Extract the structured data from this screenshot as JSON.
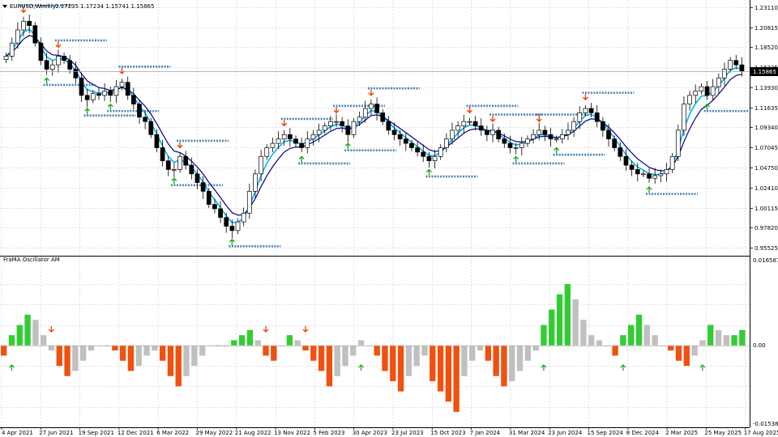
{
  "main_chart": {
    "symbol_label": "EURUSD,Weekly",
    "ohlc_label": "1.17235 1.17234 1.15741 1.15865",
    "current_price": "1.15865",
    "price_labels": [
      "1.23110",
      "1.20815",
      "1.18520",
      "1.16225",
      "1.13930",
      "1.11635",
      "1.09340",
      "1.07045",
      "1.04750",
      "1.02410",
      "1.00115",
      "0.97820",
      "0.95525"
    ],
    "colors": {
      "bull": "#ffffff",
      "bear": "#000000",
      "fast_line": "#00b7eb",
      "slow_line": "#00008b",
      "dash": "#4682b4",
      "arrow_up": "#22aa22",
      "arrow_down": "#ee4400",
      "price_tag": "#000000"
    }
  },
  "oscillator": {
    "title": "FraMA Oscillator AM",
    "scale_labels": [
      "0.016587",
      "0.00",
      "-0.015384"
    ],
    "colors": {
      "pos_strong": "#33cc33",
      "neg_strong": "#f05010",
      "weak": "#c0c0c0"
    }
  },
  "x_axis": {
    "labels": [
      "4 Apr 2021",
      "27 Jun 2021",
      "19 Sep 2021",
      "12 Dec 2021",
      "6 Mar 2022",
      "29 May 2022",
      "21 Aug 2022",
      "13 Nov 2022",
      "5 Feb 2023",
      "30 Apr 2023",
      "23 Jul 2023",
      "15 Oct 2023",
      "7 Jan 2024",
      "31 Mar 2024",
      "23 Jun 2024",
      "15 Sep 2024",
      "8 Dec 2024",
      "2 Mar 2025",
      "25 May 2025",
      "17 Aug 2025"
    ]
  },
  "chart_data": [
    {
      "type": "candlestick",
      "title": "EURUSD,Weekly",
      "ylim": [
        0.948,
        1.2375
      ],
      "close_series": [
        1.175,
        1.19,
        1.205,
        1.215,
        1.21,
        1.19,
        1.17,
        1.16,
        1.165,
        1.175,
        1.17,
        1.16,
        1.15,
        1.13,
        1.125,
        1.132,
        1.13,
        1.135,
        1.13,
        1.14,
        1.145,
        1.13,
        1.12,
        1.105,
        1.1,
        1.085,
        1.07,
        1.055,
        1.045,
        1.045,
        1.06,
        1.05,
        1.04,
        1.03,
        1.02,
        1.005,
        1.0,
        0.99,
        0.98,
        0.975,
        0.985,
        0.995,
        1.02,
        1.04,
        1.06,
        1.07,
        1.075,
        1.08,
        1.085,
        1.08,
        1.075,
        1.07,
        1.08,
        1.085,
        1.09,
        1.095,
        1.1,
        1.1,
        1.095,
        1.085,
        1.1,
        1.105,
        1.115,
        1.12,
        1.11,
        1.1,
        1.09,
        1.085,
        1.08,
        1.075,
        1.07,
        1.065,
        1.06,
        1.055,
        1.06,
        1.07,
        1.08,
        1.09,
        1.095,
        1.1,
        1.1,
        1.095,
        1.09,
        1.085,
        1.09,
        1.08,
        1.075,
        1.07,
        1.07,
        1.075,
        1.08,
        1.085,
        1.09,
        1.085,
        1.08,
        1.08,
        1.085,
        1.09,
        1.1,
        1.11,
        1.115,
        1.11,
        1.1,
        1.09,
        1.08,
        1.07,
        1.06,
        1.05,
        1.045,
        1.04,
        1.04,
        1.035,
        1.038,
        1.04,
        1.045,
        1.06,
        1.09,
        1.12,
        1.13,
        1.135,
        1.14,
        1.13,
        1.14,
        1.15,
        1.16,
        1.17,
        1.165,
        1.158
      ],
      "series": [
        {
          "name": "EURUSD",
          "last": 1.15865
        }
      ]
    },
    {
      "type": "bar",
      "title": "FraMA Oscillator AM",
      "ylim": [
        -0.015384,
        0.016587
      ],
      "values": [
        -0.002,
        0.002,
        0.004,
        0.006,
        0.005,
        0.002,
        -0.001,
        -0.004,
        -0.006,
        -0.005,
        -0.003,
        -0.001,
        0.0,
        0.0,
        -0.001,
        -0.003,
        -0.005,
        -0.004,
        -0.002,
        -0.001,
        -0.003,
        -0.006,
        -0.008,
        -0.006,
        -0.004,
        -0.002,
        0.0,
        0.0,
        0.0,
        0.001,
        0.002,
        0.003,
        0.001,
        -0.002,
        -0.003,
        0.0,
        0.002,
        0.001,
        -0.001,
        -0.003,
        -0.005,
        -0.008,
        -0.006,
        -0.004,
        -0.002,
        0.001,
        0.0,
        -0.002,
        -0.005,
        -0.007,
        -0.009,
        -0.006,
        -0.004,
        -0.002,
        -0.007,
        -0.009,
        -0.011,
        -0.013,
        -0.006,
        -0.003,
        -0.001,
        -0.003,
        -0.006,
        -0.008,
        -0.007,
        -0.005,
        -0.003,
        -0.001,
        0.004,
        0.007,
        0.01,
        0.012,
        0.009,
        0.005,
        0.002,
        0.001,
        0.0,
        -0.002,
        0.002,
        0.004,
        0.006,
        0.004,
        0.002,
        0.0,
        -0.001,
        -0.003,
        -0.004,
        -0.002,
        0.001,
        0.004,
        0.003,
        0.002,
        0.002,
        0.003
      ],
      "series": [
        {
          "name": "FraMA Oscillator AM"
        }
      ]
    }
  ]
}
